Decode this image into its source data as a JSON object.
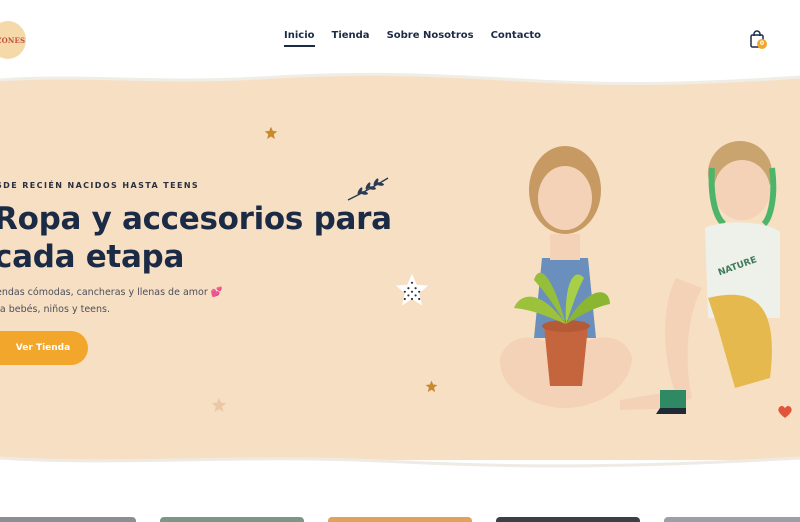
{
  "header": {
    "logo_text": "AZONES",
    "nav": [
      {
        "label": "Inicio",
        "active": true
      },
      {
        "label": "Tienda",
        "active": false
      },
      {
        "label": "Sobre Nosotros",
        "active": false
      },
      {
        "label": "Contacto",
        "active": false
      }
    ],
    "cart": {
      "icon": "shopping-bag-icon",
      "count": "0"
    }
  },
  "hero": {
    "eyebrow": "SDE RECIÉN NACIDOS HASTA TEENS",
    "headline_line1": "Ropa y accesorios para",
    "headline_line2": "cada etapa",
    "desc_line1": "endas cómodas, cancheras y llenas de amor 💕",
    "desc_line2": "ra bebés, niños y teens.",
    "cta_label": "Ver Tienda"
  },
  "colors": {
    "hero_bg": "#f7dfc4",
    "accent": "#f2a62b",
    "text_dark": "#1b2b46"
  }
}
